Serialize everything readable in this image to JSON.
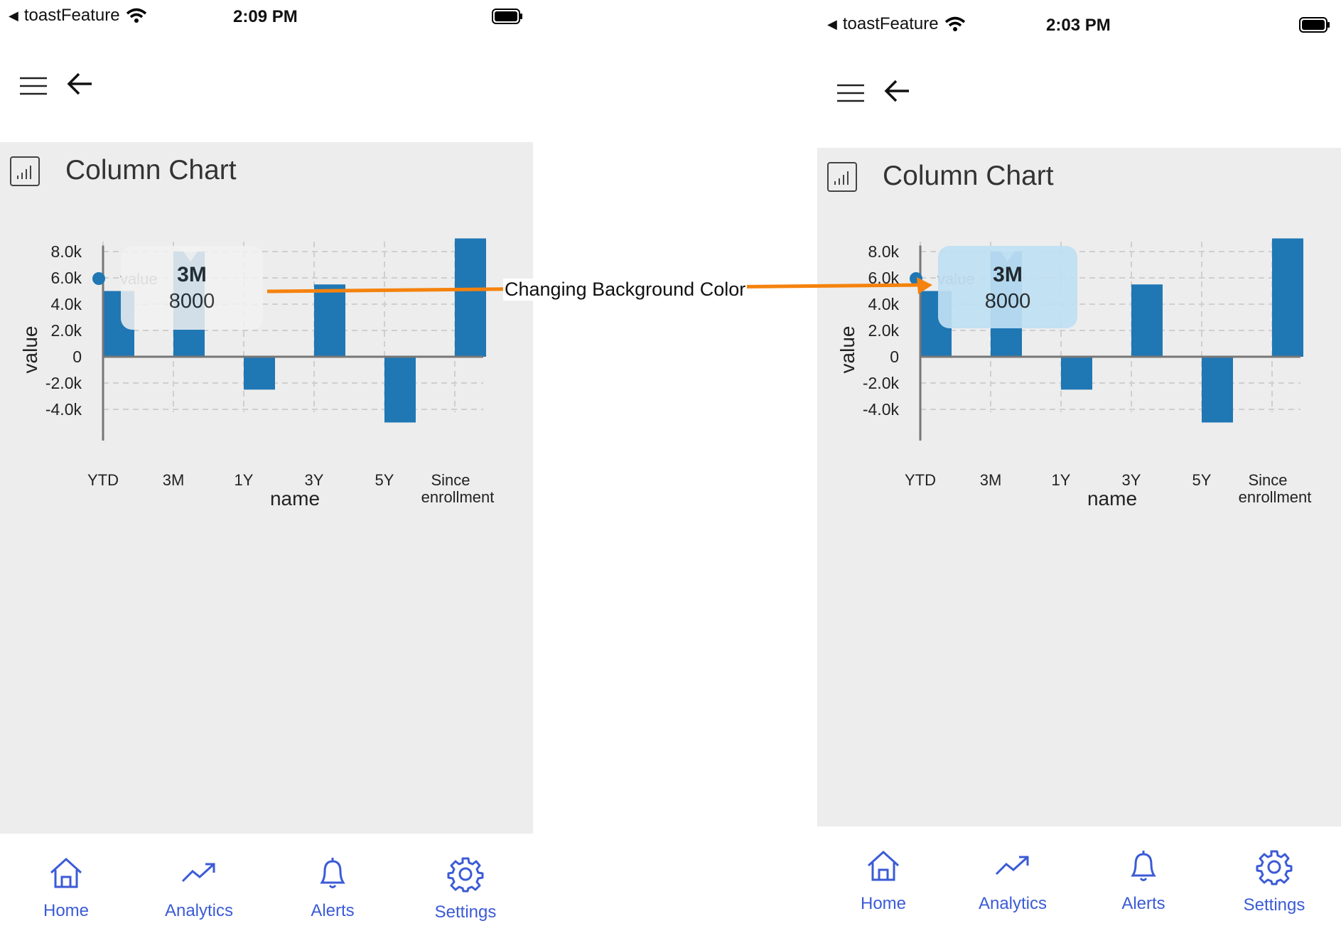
{
  "annotation": {
    "label": "Changing Background Color",
    "color": "#f5820d"
  },
  "screens": [
    {
      "status": {
        "carrier": "toastFeature",
        "time": "2:09 PM"
      },
      "card_title": "Column Chart",
      "tooltip": {
        "title": "3M",
        "value": "8000",
        "background": "#f2f2f2"
      },
      "tabs": [
        {
          "label": "Home",
          "icon": "home-icon"
        },
        {
          "label": "Analytics",
          "icon": "analytics-trend-icon"
        },
        {
          "label": "Alerts",
          "icon": "bell-icon"
        },
        {
          "label": "Settings",
          "icon": "gear-icon"
        }
      ]
    },
    {
      "status": {
        "carrier": "toastFeature",
        "time": "2:03 PM"
      },
      "card_title": "Column Chart",
      "tooltip": {
        "title": "3M",
        "value": "8000",
        "background": "#bfe0f3"
      },
      "tabs": [
        {
          "label": "Home",
          "icon": "home-icon"
        },
        {
          "label": "Analytics",
          "icon": "analytics-trend-icon"
        },
        {
          "label": "Alerts",
          "icon": "bell-icon"
        },
        {
          "label": "Settings",
          "icon": "gear-icon"
        }
      ]
    }
  ],
  "chart_data": {
    "type": "bar",
    "categories": [
      "YTD",
      "3M",
      "1Y",
      "3Y",
      "5Y",
      "Since enrollment"
    ],
    "series": [
      {
        "name": "value",
        "values": [
          5000,
          8000,
          -2500,
          5500,
          -5000,
          9000
        ],
        "color": "#1f77b4"
      }
    ],
    "xlabel": "name",
    "ylabel": "value",
    "ylim": [
      -4000,
      8000
    ],
    "yticks": [
      "8.0k",
      "6.0k",
      "4.0k",
      "2.0k",
      "0",
      "-2.0k",
      "-4.0k"
    ],
    "grid": true,
    "legend": "top-left"
  }
}
